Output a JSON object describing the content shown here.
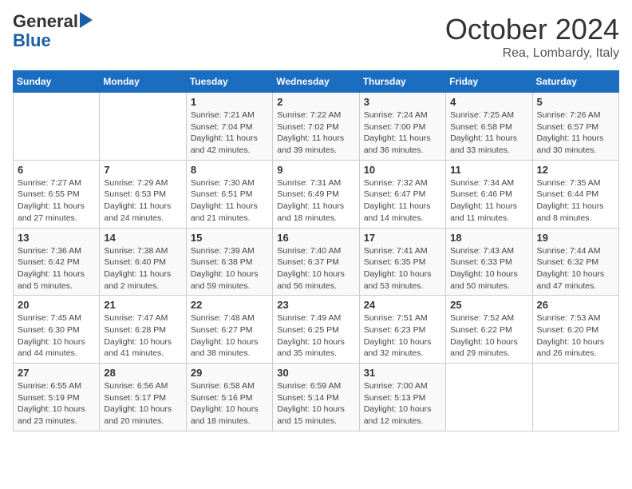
{
  "header": {
    "logo_line1": "General",
    "logo_line2": "Blue",
    "month": "October 2024",
    "location": "Rea, Lombardy, Italy"
  },
  "weekdays": [
    "Sunday",
    "Monday",
    "Tuesday",
    "Wednesday",
    "Thursday",
    "Friday",
    "Saturday"
  ],
  "weeks": [
    [
      {
        "day": "",
        "info": ""
      },
      {
        "day": "",
        "info": ""
      },
      {
        "day": "1",
        "info": "Sunrise: 7:21 AM\nSunset: 7:04 PM\nDaylight: 11 hours and 42 minutes."
      },
      {
        "day": "2",
        "info": "Sunrise: 7:22 AM\nSunset: 7:02 PM\nDaylight: 11 hours and 39 minutes."
      },
      {
        "day": "3",
        "info": "Sunrise: 7:24 AM\nSunset: 7:00 PM\nDaylight: 11 hours and 36 minutes."
      },
      {
        "day": "4",
        "info": "Sunrise: 7:25 AM\nSunset: 6:58 PM\nDaylight: 11 hours and 33 minutes."
      },
      {
        "day": "5",
        "info": "Sunrise: 7:26 AM\nSunset: 6:57 PM\nDaylight: 11 hours and 30 minutes."
      }
    ],
    [
      {
        "day": "6",
        "info": "Sunrise: 7:27 AM\nSunset: 6:55 PM\nDaylight: 11 hours and 27 minutes."
      },
      {
        "day": "7",
        "info": "Sunrise: 7:29 AM\nSunset: 6:53 PM\nDaylight: 11 hours and 24 minutes."
      },
      {
        "day": "8",
        "info": "Sunrise: 7:30 AM\nSunset: 6:51 PM\nDaylight: 11 hours and 21 minutes."
      },
      {
        "day": "9",
        "info": "Sunrise: 7:31 AM\nSunset: 6:49 PM\nDaylight: 11 hours and 18 minutes."
      },
      {
        "day": "10",
        "info": "Sunrise: 7:32 AM\nSunset: 6:47 PM\nDaylight: 11 hours and 14 minutes."
      },
      {
        "day": "11",
        "info": "Sunrise: 7:34 AM\nSunset: 6:46 PM\nDaylight: 11 hours and 11 minutes."
      },
      {
        "day": "12",
        "info": "Sunrise: 7:35 AM\nSunset: 6:44 PM\nDaylight: 11 hours and 8 minutes."
      }
    ],
    [
      {
        "day": "13",
        "info": "Sunrise: 7:36 AM\nSunset: 6:42 PM\nDaylight: 11 hours and 5 minutes."
      },
      {
        "day": "14",
        "info": "Sunrise: 7:38 AM\nSunset: 6:40 PM\nDaylight: 11 hours and 2 minutes."
      },
      {
        "day": "15",
        "info": "Sunrise: 7:39 AM\nSunset: 6:38 PM\nDaylight: 10 hours and 59 minutes."
      },
      {
        "day": "16",
        "info": "Sunrise: 7:40 AM\nSunset: 6:37 PM\nDaylight: 10 hours and 56 minutes."
      },
      {
        "day": "17",
        "info": "Sunrise: 7:41 AM\nSunset: 6:35 PM\nDaylight: 10 hours and 53 minutes."
      },
      {
        "day": "18",
        "info": "Sunrise: 7:43 AM\nSunset: 6:33 PM\nDaylight: 10 hours and 50 minutes."
      },
      {
        "day": "19",
        "info": "Sunrise: 7:44 AM\nSunset: 6:32 PM\nDaylight: 10 hours and 47 minutes."
      }
    ],
    [
      {
        "day": "20",
        "info": "Sunrise: 7:45 AM\nSunset: 6:30 PM\nDaylight: 10 hours and 44 minutes."
      },
      {
        "day": "21",
        "info": "Sunrise: 7:47 AM\nSunset: 6:28 PM\nDaylight: 10 hours and 41 minutes."
      },
      {
        "day": "22",
        "info": "Sunrise: 7:48 AM\nSunset: 6:27 PM\nDaylight: 10 hours and 38 minutes."
      },
      {
        "day": "23",
        "info": "Sunrise: 7:49 AM\nSunset: 6:25 PM\nDaylight: 10 hours and 35 minutes."
      },
      {
        "day": "24",
        "info": "Sunrise: 7:51 AM\nSunset: 6:23 PM\nDaylight: 10 hours and 32 minutes."
      },
      {
        "day": "25",
        "info": "Sunrise: 7:52 AM\nSunset: 6:22 PM\nDaylight: 10 hours and 29 minutes."
      },
      {
        "day": "26",
        "info": "Sunrise: 7:53 AM\nSunset: 6:20 PM\nDaylight: 10 hours and 26 minutes."
      }
    ],
    [
      {
        "day": "27",
        "info": "Sunrise: 6:55 AM\nSunset: 5:19 PM\nDaylight: 10 hours and 23 minutes."
      },
      {
        "day": "28",
        "info": "Sunrise: 6:56 AM\nSunset: 5:17 PM\nDaylight: 10 hours and 20 minutes."
      },
      {
        "day": "29",
        "info": "Sunrise: 6:58 AM\nSunset: 5:16 PM\nDaylight: 10 hours and 18 minutes."
      },
      {
        "day": "30",
        "info": "Sunrise: 6:59 AM\nSunset: 5:14 PM\nDaylight: 10 hours and 15 minutes."
      },
      {
        "day": "31",
        "info": "Sunrise: 7:00 AM\nSunset: 5:13 PM\nDaylight: 10 hours and 12 minutes."
      },
      {
        "day": "",
        "info": ""
      },
      {
        "day": "",
        "info": ""
      }
    ]
  ]
}
